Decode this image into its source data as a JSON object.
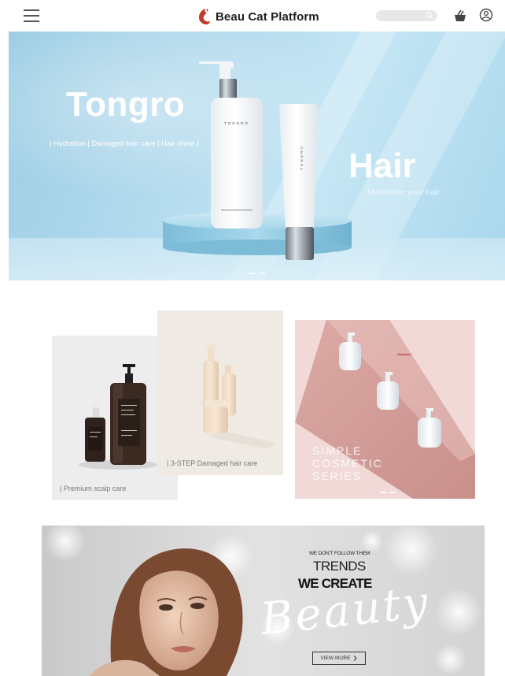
{
  "header": {
    "brand_name": "Beau Cat Platform",
    "search_placeholder": "",
    "colors": {
      "logo": "#c0392b",
      "icons": "#555555"
    }
  },
  "hero": {
    "title": "Tongro",
    "tags": "| Hydration | Damaged hair care | Hair shine |",
    "word": "Hair",
    "subtitle": "Moisturize your hair",
    "bottle_label": "TONGRO",
    "tube_label": "TONGRO",
    "slide_count": 2,
    "colors": {
      "sky": "#b9def0",
      "pedestal": "#8fcbe3"
    }
  },
  "products": {
    "card_1": {
      "caption": "| Premium scalp care"
    },
    "card_2": {
      "caption": "| 3-STEP Damaged hair care"
    },
    "card_3": {
      "line1": "SIMPLE",
      "line2": "COSMETIC",
      "line3": "SERIES",
      "mini_menu": [
        "shampoo",
        "",
        "",
        ""
      ],
      "slide_count": 2,
      "colors": {
        "bg": "#f0d9d7",
        "shelf": "#d9a9a6"
      }
    }
  },
  "banner": {
    "eyebrow": "WE DON'T FOLLOW THEM",
    "line1": "TRENDS",
    "line2": "WE CREATE",
    "script_word": "Beauty",
    "body": "",
    "cta_label": "VIEW MORE",
    "cta_icon": "chevron-right-icon"
  }
}
